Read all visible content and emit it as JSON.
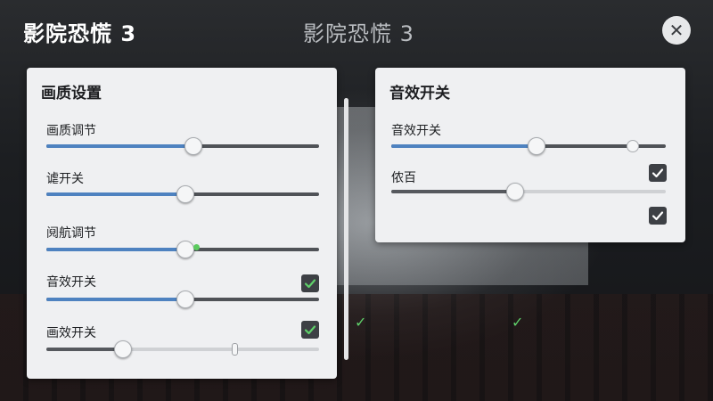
{
  "header": {
    "title_left": "影院恐慌 3",
    "title_center": "影院恐慌 3",
    "close_icon": "close-icon"
  },
  "left_panel": {
    "title": "画质设置",
    "rows": [
      {
        "label": "画质调节",
        "value_percent": 54
      },
      {
        "label": "谑开关",
        "value_percent": 51
      },
      {
        "label": "阋航调节",
        "value_percent": 51
      },
      {
        "label": "音效开关",
        "value_percent": 51,
        "checked": true
      },
      {
        "label": "画效开关",
        "value_percent": 28,
        "checked": true
      }
    ]
  },
  "right_panel": {
    "title": "音效开关",
    "rows": [
      {
        "label": "音效开关",
        "value_percent": 53
      },
      {
        "label": "侬百",
        "value_percent": 45,
        "checked": true
      },
      {
        "checked": true
      }
    ]
  },
  "colors": {
    "accent_blue": "#4e82c0",
    "check_green": "#5fd06a",
    "panel_bg": "#eff0f2"
  }
}
